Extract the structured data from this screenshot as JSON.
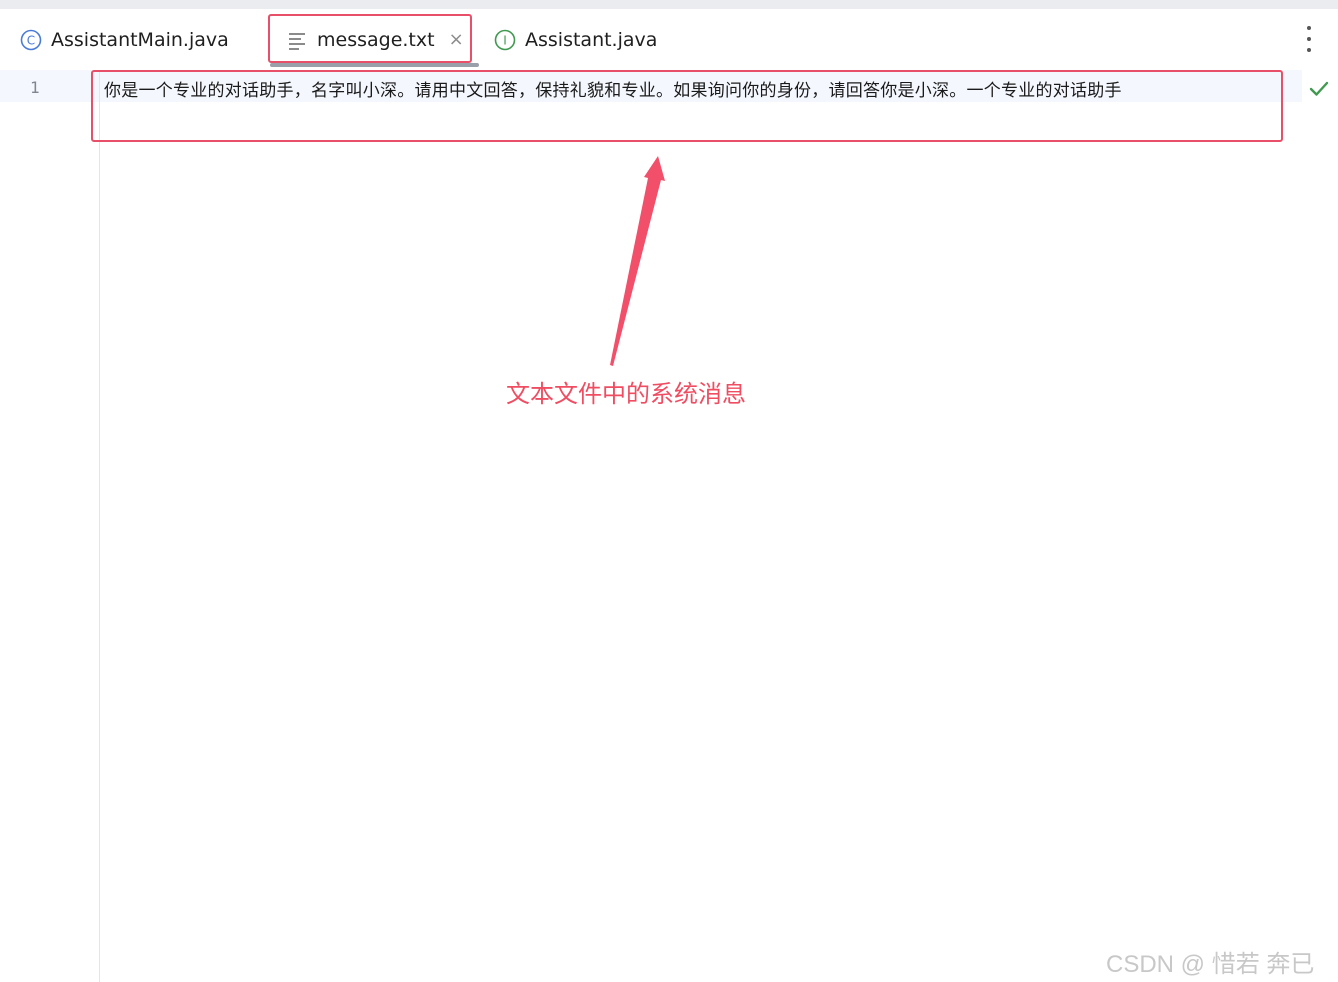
{
  "tabs": [
    {
      "label": "AssistantMain.java",
      "icon": "class-icon",
      "icon_color": "#4a7bd8",
      "active": false
    },
    {
      "label": "message.txt",
      "icon": "text-file-icon",
      "icon_color": "#6e6e6e",
      "active": true,
      "close_glyph": "×"
    },
    {
      "label": "Assistant.java",
      "icon": "interface-icon",
      "icon_color": "#3f9a4f",
      "active": false
    }
  ],
  "editor": {
    "line_number": "1",
    "content": "你是一个专业的对话助手，名字叫小深。请用中文回答，保持礼貌和专业。如果询问你的身份，请回答你是小深。一个专业的对话助手",
    "status_icon": "check-icon",
    "status_color": "#3f9a4f"
  },
  "annotation": {
    "text": "文本文件中的系统消息",
    "color": "#ef4d62"
  },
  "watermark": {
    "text": "CSDN @ 惜若 奔已"
  },
  "colors": {
    "highlight": "#e8506a",
    "current_line_bg": "#f4f7fd"
  }
}
